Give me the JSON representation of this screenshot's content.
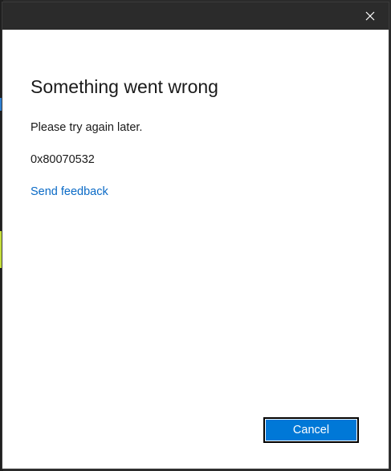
{
  "dialog": {
    "title": "Something went wrong",
    "message": "Please try again later.",
    "error_code": "0x80070532",
    "feedback_link": "Send feedback",
    "cancel_label": "Cancel"
  },
  "icons": {
    "close": "close-icon"
  },
  "colors": {
    "titlebar": "#2b2b2b",
    "link": "#0a6ac6",
    "button_bg": "#0078d7",
    "button_text": "#ffffff"
  }
}
